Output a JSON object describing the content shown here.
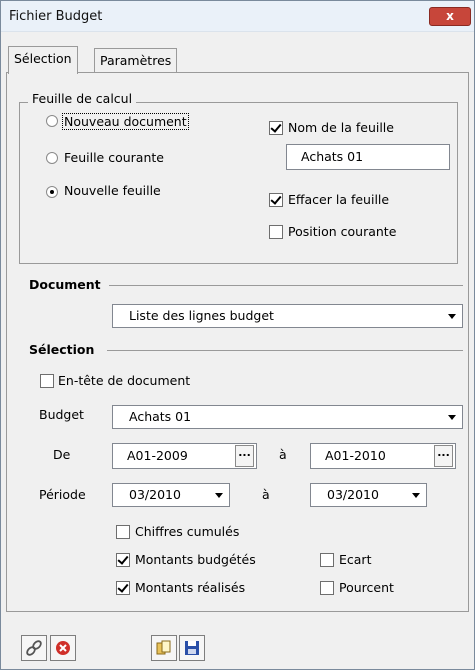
{
  "window": {
    "title": "Fichier Budget",
    "close_label": "x"
  },
  "tabs": [
    {
      "label": "Sélection",
      "active": true
    },
    {
      "label": "Paramètres",
      "active": false
    }
  ],
  "worksheet_group": {
    "legend": "Feuille de calcul",
    "options": [
      {
        "label": "Nouveau document",
        "checked": false
      },
      {
        "label": "Feuille courante",
        "checked": false
      },
      {
        "label": "Nouvelle feuille",
        "checked": true
      }
    ],
    "sheet_name": {
      "label": "Nom de la feuille",
      "checked": true,
      "value": "Achats 01"
    },
    "clear_sheet": {
      "label": "Effacer la feuille",
      "checked": true
    },
    "current_position": {
      "label": "Position courante",
      "checked": false
    }
  },
  "document": {
    "header": "Document",
    "selected": "Liste des lignes budget"
  },
  "selection": {
    "header": "Sélection",
    "doc_header_checkbox": {
      "label": "En-tête de document",
      "checked": false
    },
    "budget": {
      "label": "Budget",
      "selected": "Achats 01"
    },
    "range": {
      "from_label": "De",
      "from_value": "A01-2009",
      "to_label": "à",
      "to_value": "A01-2010",
      "button_label": "..."
    },
    "period": {
      "label": "Période",
      "from_value": "03/2010",
      "to_label": "à",
      "to_value": "03/2010"
    },
    "options": {
      "cumulative": {
        "label": "Chiffres cumulés",
        "checked": false
      },
      "budgeted": {
        "label": "Montants budgétés",
        "checked": true
      },
      "actual": {
        "label": "Montants réalisés",
        "checked": true
      },
      "variance": {
        "label": "Ecart",
        "checked": false
      },
      "percent": {
        "label": "Pourcent",
        "checked": false
      }
    }
  },
  "toolbar": {
    "icons": [
      "link-icon",
      "cancel-icon",
      "copy-icon",
      "save-icon"
    ],
    "colors": {
      "cancel": "#d0302a",
      "save": "#2a4fa8"
    }
  }
}
